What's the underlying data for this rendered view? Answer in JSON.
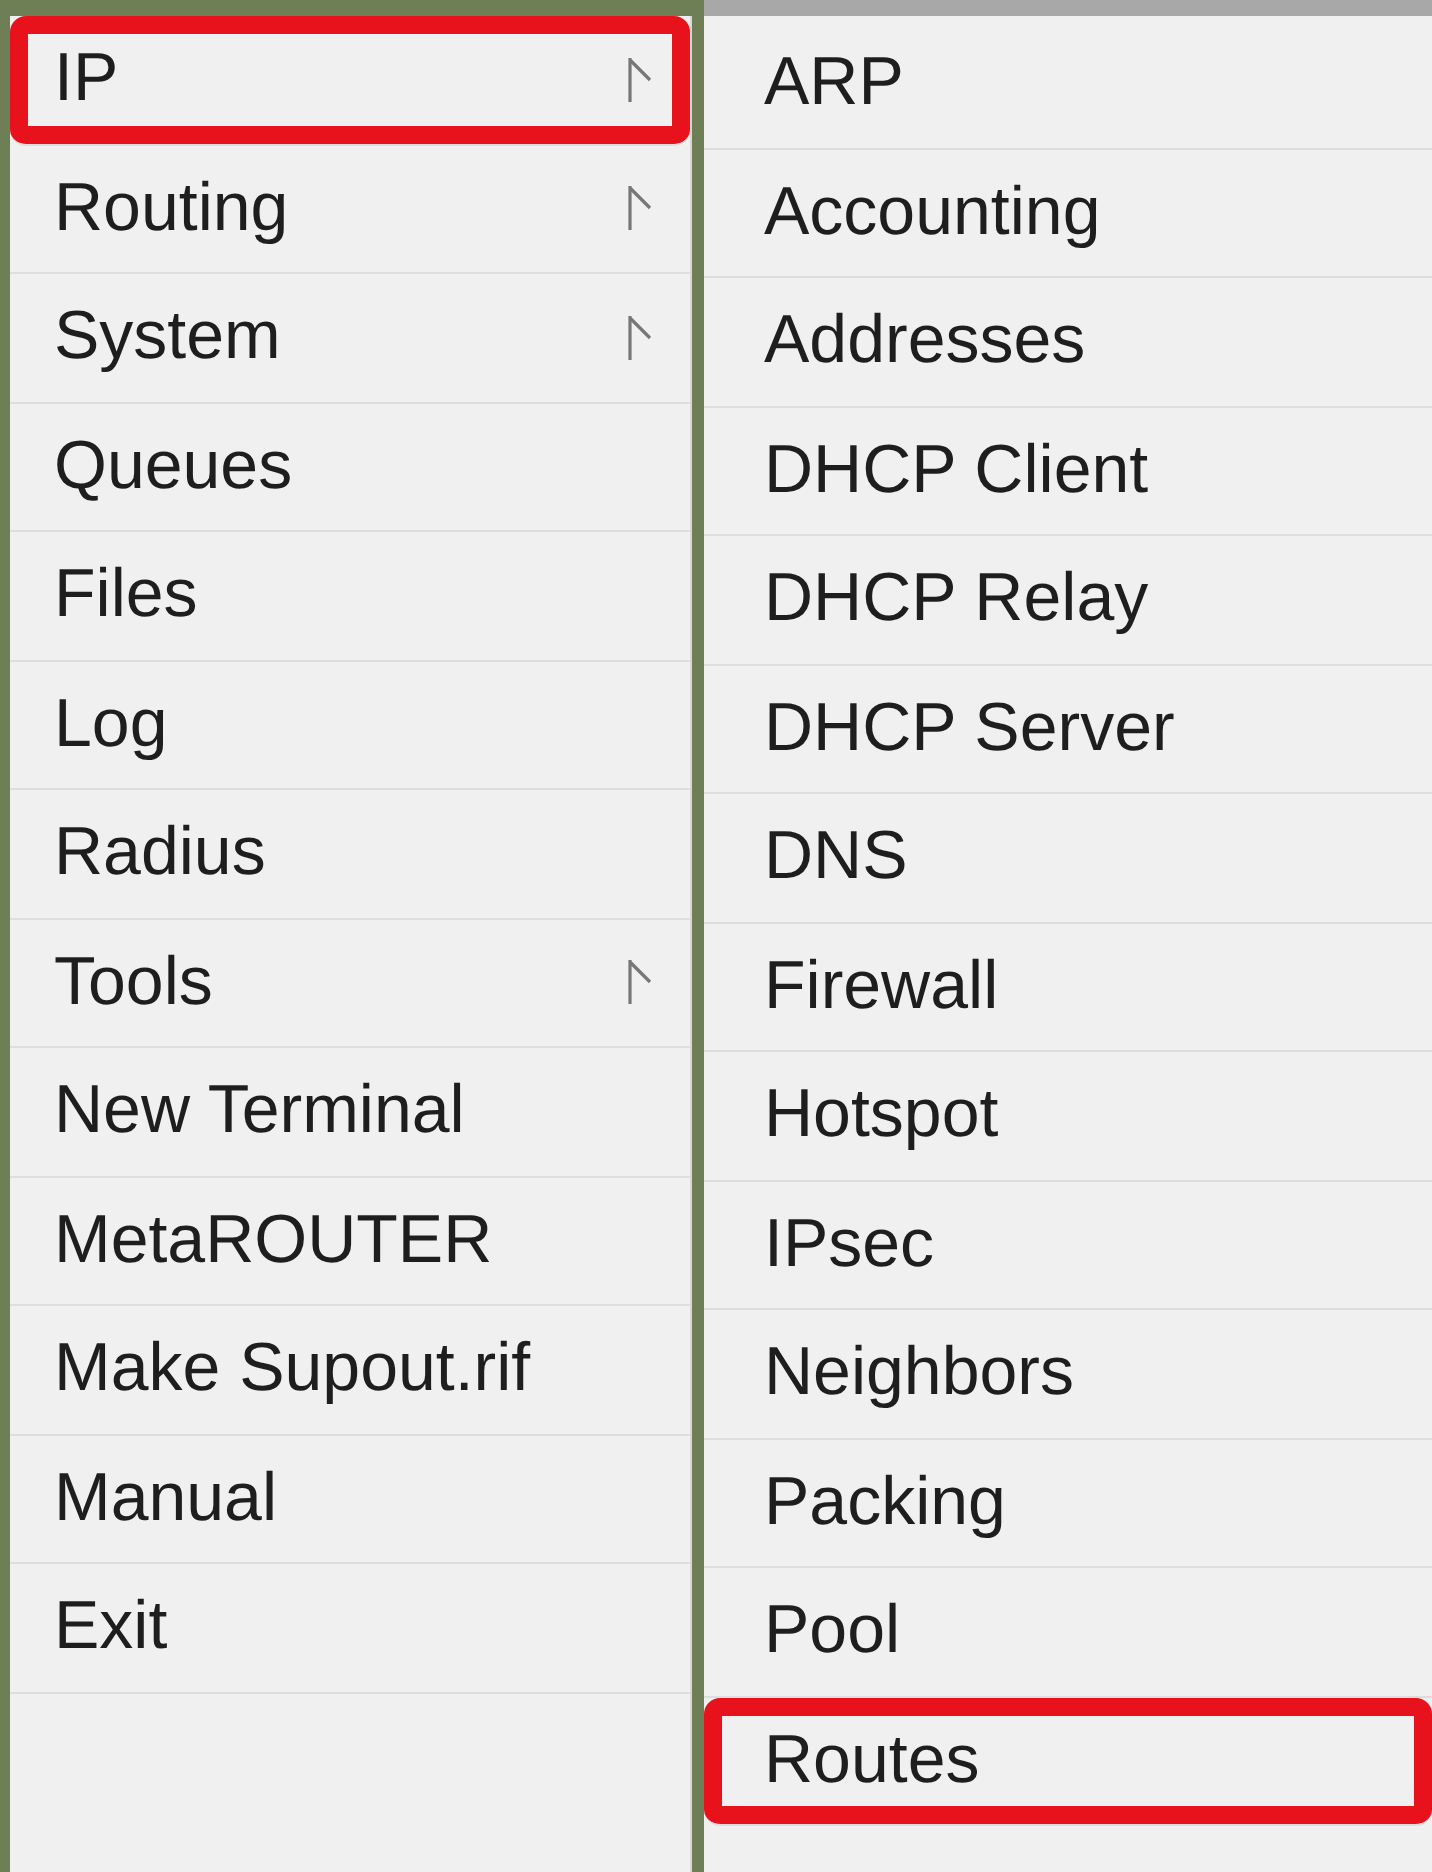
{
  "main_menu": {
    "items": [
      {
        "label": "IP",
        "has_submenu": true,
        "highlighted": true
      },
      {
        "label": "Routing",
        "has_submenu": true,
        "highlighted": false
      },
      {
        "label": "System",
        "has_submenu": true,
        "highlighted": false
      },
      {
        "label": "Queues",
        "has_submenu": false,
        "highlighted": false
      },
      {
        "label": "Files",
        "has_submenu": false,
        "highlighted": false
      },
      {
        "label": "Log",
        "has_submenu": false,
        "highlighted": false
      },
      {
        "label": "Radius",
        "has_submenu": false,
        "highlighted": false
      },
      {
        "label": "Tools",
        "has_submenu": true,
        "highlighted": false
      },
      {
        "label": "New Terminal",
        "has_submenu": false,
        "highlighted": false
      },
      {
        "label": "MetaROUTER",
        "has_submenu": false,
        "highlighted": false
      },
      {
        "label": "Make Supout.rif",
        "has_submenu": false,
        "highlighted": false
      },
      {
        "label": "Manual",
        "has_submenu": false,
        "highlighted": false
      },
      {
        "label": "Exit",
        "has_submenu": false,
        "highlighted": false
      }
    ]
  },
  "submenu": {
    "items": [
      {
        "label": "ARP",
        "highlighted": false
      },
      {
        "label": "Accounting",
        "highlighted": false
      },
      {
        "label": "Addresses",
        "highlighted": false
      },
      {
        "label": "DHCP Client",
        "highlighted": false
      },
      {
        "label": "DHCP Relay",
        "highlighted": false
      },
      {
        "label": "DHCP Server",
        "highlighted": false
      },
      {
        "label": "DNS",
        "highlighted": false
      },
      {
        "label": "Firewall",
        "highlighted": false
      },
      {
        "label": "Hotspot",
        "highlighted": false
      },
      {
        "label": "IPsec",
        "highlighted": false
      },
      {
        "label": "Neighbors",
        "highlighted": false
      },
      {
        "label": "Packing",
        "highlighted": false
      },
      {
        "label": "Pool",
        "highlighted": false
      },
      {
        "label": "Routes",
        "highlighted": true
      }
    ]
  }
}
